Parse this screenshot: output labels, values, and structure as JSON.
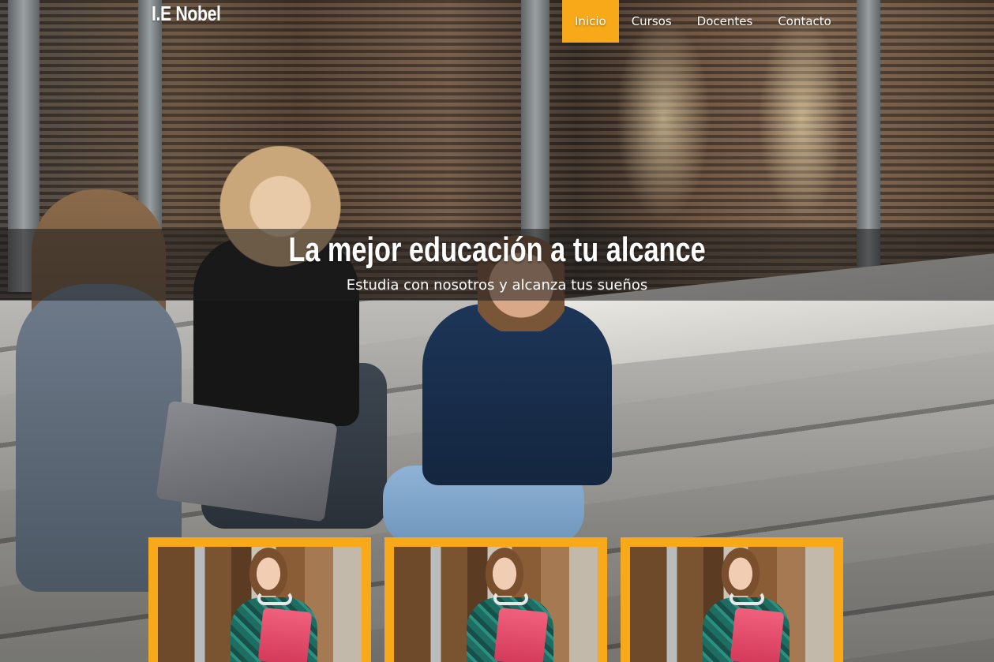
{
  "brand": {
    "name": "I.E Nobel"
  },
  "nav": {
    "items": [
      {
        "label": "Inicio",
        "active": true
      },
      {
        "label": "Cursos",
        "active": false
      },
      {
        "label": "Docentes",
        "active": false
      },
      {
        "label": "Contacto",
        "active": false
      }
    ]
  },
  "hero": {
    "title": "La mejor educación a tu alcance",
    "subtitle": "Estudia con nosotros y alcanza tus sueños",
    "background": "students-sitting-on-steps-photo"
  },
  "cards": [
    {
      "image": "student-holding-book-photo"
    },
    {
      "image": "student-holding-book-photo"
    },
    {
      "image": "student-holding-book-photo"
    }
  ],
  "colors": {
    "accent": "#f7a919",
    "nav_text": "#ffffff",
    "caption_band": "rgba(30,30,30,0.55)"
  }
}
